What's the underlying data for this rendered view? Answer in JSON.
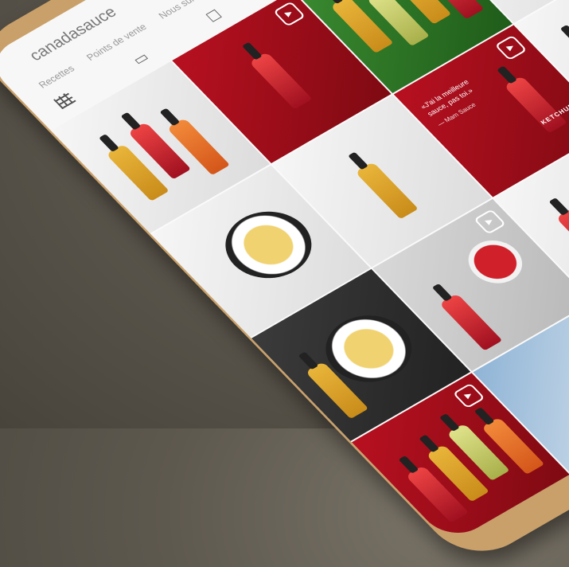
{
  "profile": {
    "username": "canadasauce",
    "status_bar": "· · · ▮",
    "tabs": [
      "Recettes",
      "Points de vente",
      "Nous suivre"
    ]
  },
  "posts": [
    {
      "kind": "white-bottles",
      "bg": "t-white",
      "video": false
    },
    {
      "kind": "red-bottle",
      "bg": "t-red",
      "video": true
    },
    {
      "kind": "green-bottles",
      "bg": "t-green",
      "video": false
    },
    {
      "kind": "white-bottles-2",
      "bg": "t-white",
      "video": false
    },
    {
      "kind": "pasta-dish",
      "bg": "t-white",
      "video": false
    },
    {
      "kind": "yellow-bottle",
      "bg": "t-white",
      "video": false
    },
    {
      "kind": "quote-red",
      "bg": "t-red",
      "video": true,
      "quote": "«J'ai la meilleure sauce, pas toi.»",
      "author": "— Mam Sauce",
      "chip": "KETCHUP"
    },
    {
      "kind": "salad-bottles",
      "bg": "t-white",
      "video": false
    },
    {
      "kind": "dip-platter",
      "bg": "t-dark",
      "video": false
    },
    {
      "kind": "cocktail",
      "bg": "t-grey",
      "video": true
    },
    {
      "kind": "red-bottles-row",
      "bg": "t-white",
      "video": false
    },
    {
      "kind": "beach",
      "bg": "t-blue",
      "video": false
    },
    {
      "kind": "bottle-lineup",
      "bg": "t-red",
      "video": true
    },
    {
      "kind": "beach-2",
      "bg": "t-blue",
      "video": false
    },
    {
      "kind": "red-video",
      "bg": "t-red",
      "video": true
    },
    {
      "kind": "white-3",
      "bg": "t-white",
      "video": false
    }
  ],
  "colors": {
    "brand_red": "#b81020",
    "phone_gold": "#c9a06a",
    "table": "#5e594f"
  }
}
